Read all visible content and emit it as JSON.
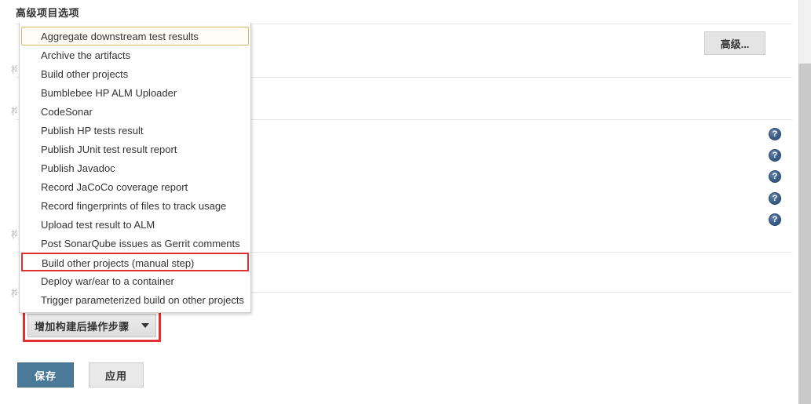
{
  "section": {
    "title": "高级项目选项"
  },
  "advanced": {
    "button_label": "高级..."
  },
  "ghost_labels": [
    "构",
    "构",
    "构",
    "构"
  ],
  "help_icons": [
    {
      "name": "help-icon-1",
      "glyph": "?"
    },
    {
      "name": "help-icon-2",
      "glyph": "?"
    },
    {
      "name": "help-icon-3",
      "glyph": "?"
    },
    {
      "name": "help-icon-4",
      "glyph": "?"
    },
    {
      "name": "help-icon-5",
      "glyph": "?"
    }
  ],
  "postbuild": {
    "button_label": "增加构建后操作步骤",
    "caret_icon": "chevron-down-icon",
    "highlight_color": "#e03030"
  },
  "actions": {
    "save_label": "保存",
    "apply_label": "应用",
    "save_color": "#4a7a97",
    "apply_color": "#e9e9e9"
  },
  "dropdown": {
    "selected_index": 0,
    "highlight_index": 12,
    "selected_border_color": "#d8b964",
    "highlight_border_color": "#e03030",
    "items": [
      "Aggregate downstream test results",
      "Archive the artifacts",
      "Build other projects",
      "Bumblebee HP ALM Uploader",
      "CodeSonar",
      "Publish HP tests result",
      "Publish JUnit test result report",
      "Publish Javadoc",
      "Record JaCoCo coverage report",
      "Record fingerprints of files to track usage",
      "Upload test result to ALM",
      "Post SonarQube issues as Gerrit comments",
      "Build other projects (manual step)",
      "Deploy war/ear to a container",
      "Trigger parameterized build on other projects"
    ]
  }
}
